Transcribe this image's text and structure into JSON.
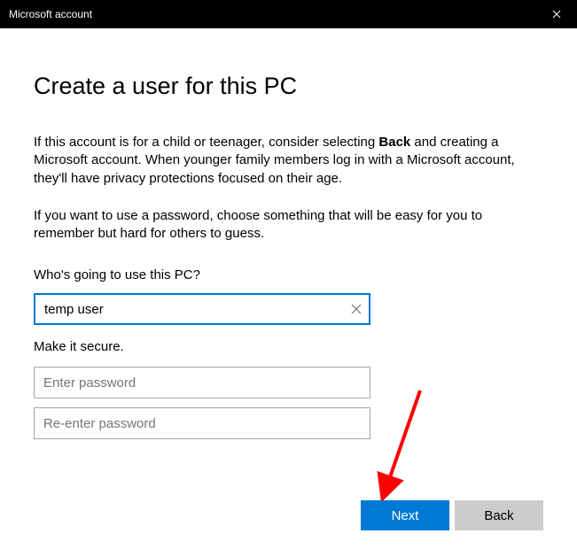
{
  "window": {
    "title": "Microsoft account"
  },
  "page": {
    "heading": "Create a user for this PC",
    "paragraph1_pre": "If this account is for a child or teenager, consider selecting ",
    "paragraph1_bold": "Back",
    "paragraph1_post": " and creating a Microsoft account. When younger family members log in with a Microsoft account, they'll have privacy protections focused on their age.",
    "paragraph2": "If you want to use a password, choose something that will be easy for you to remember but hard for others to guess."
  },
  "username": {
    "label": "Who's going to use this PC?",
    "value": "temp user"
  },
  "password": {
    "section_label": "Make it secure.",
    "placeholder1": "Enter password",
    "placeholder2": "Re-enter password"
  },
  "buttons": {
    "next": "Next",
    "back": "Back"
  }
}
